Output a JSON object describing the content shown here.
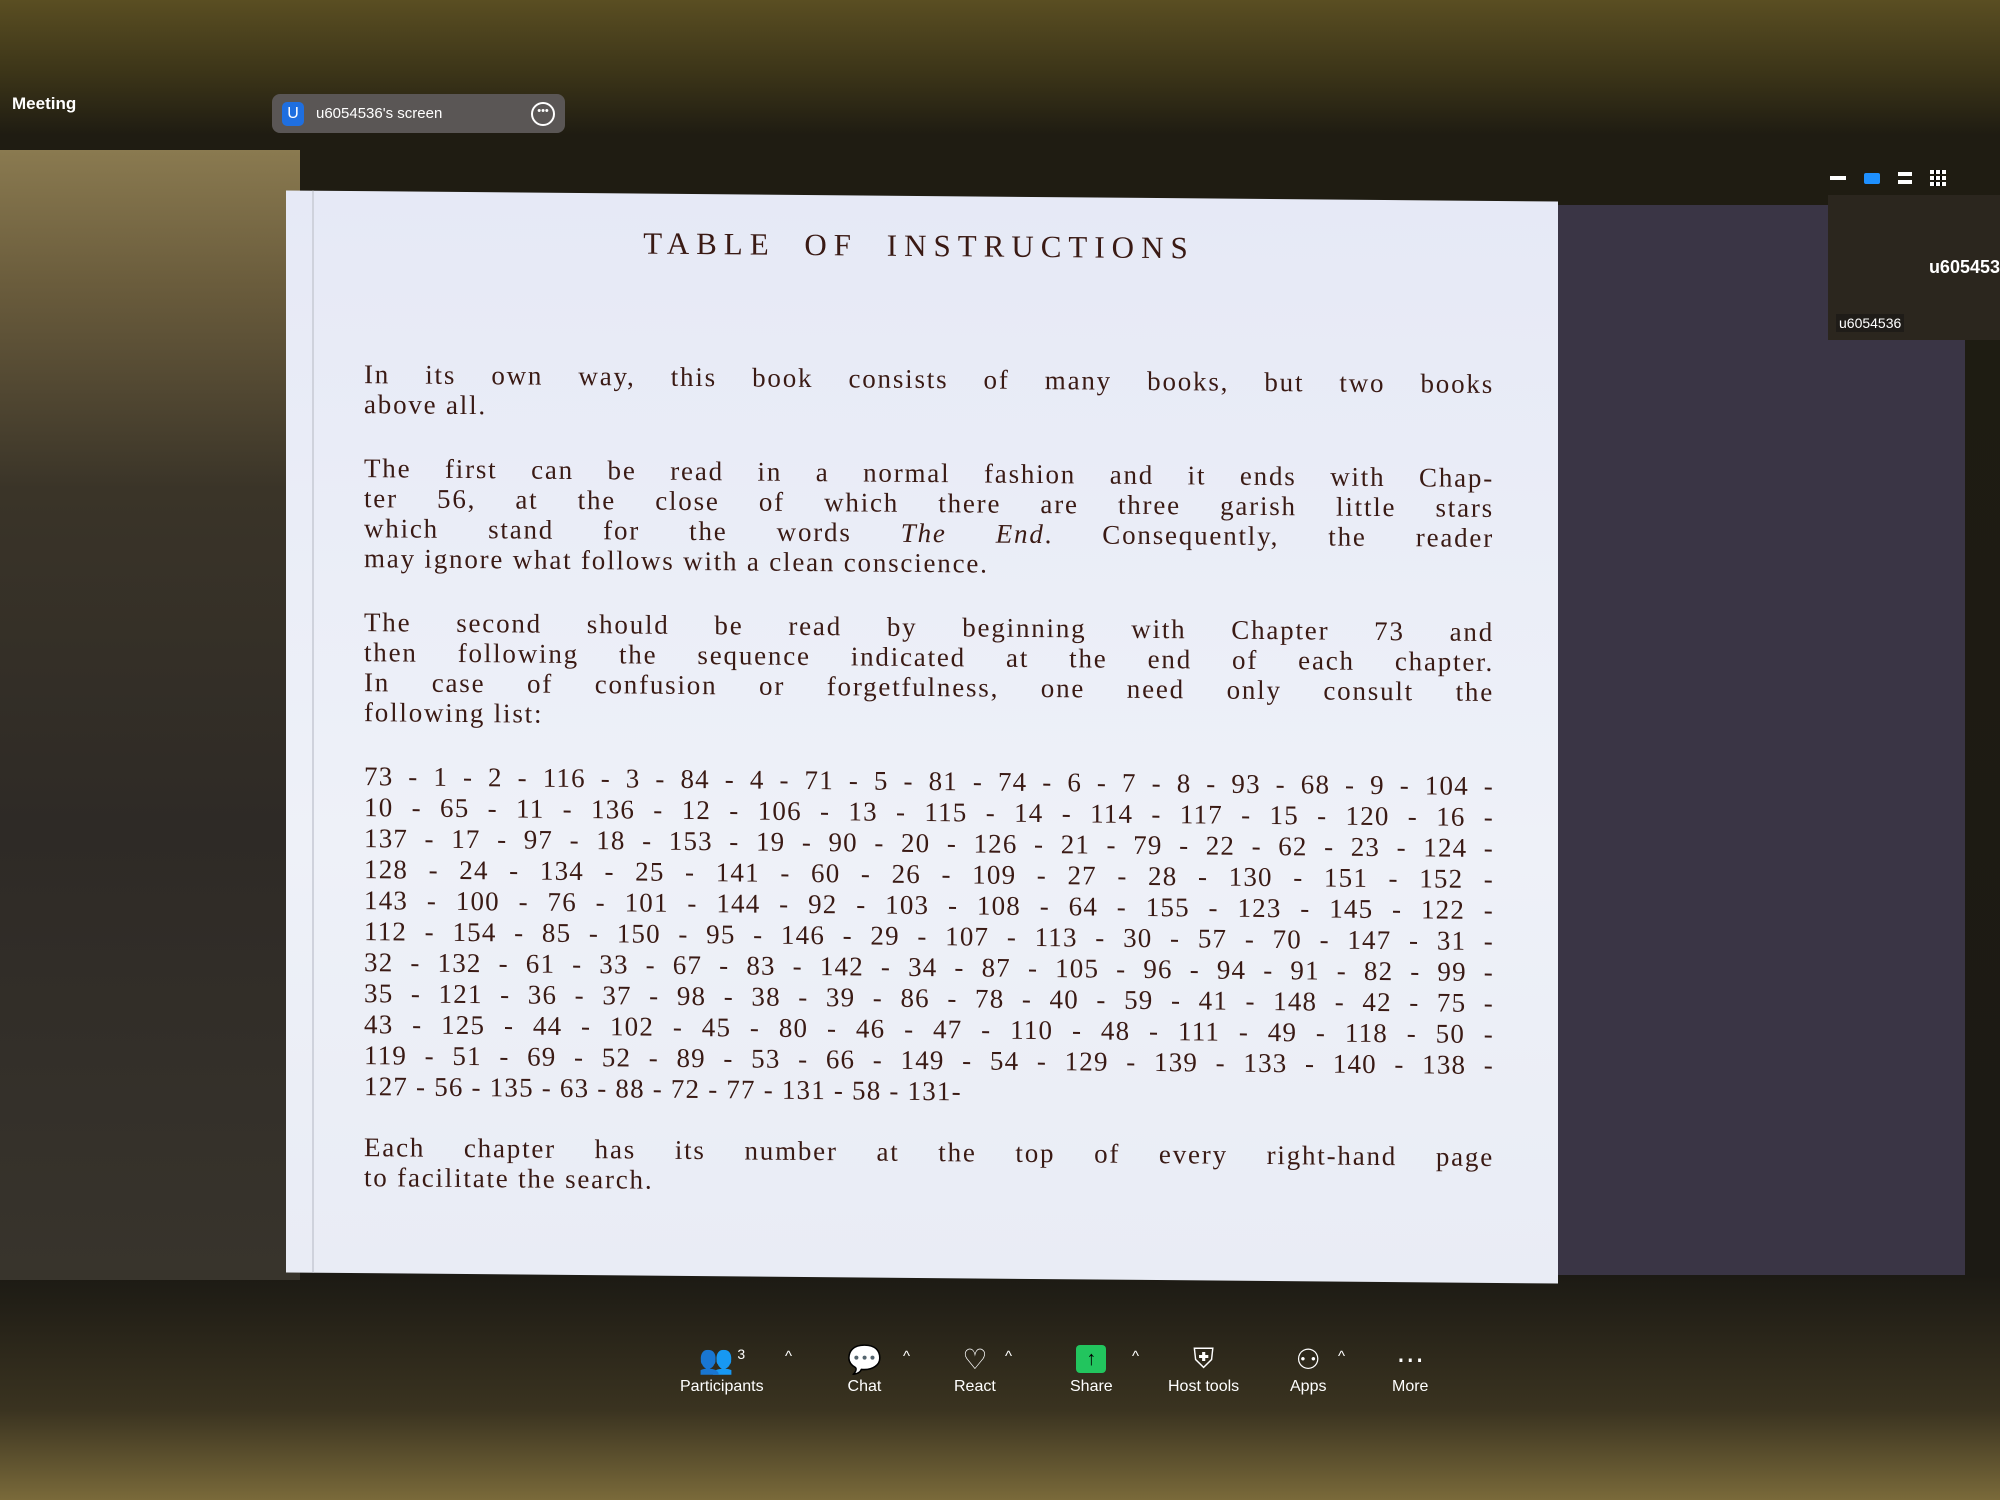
{
  "window": {
    "title": "Meeting"
  },
  "share_pill": {
    "avatar_letter": "U",
    "label": "u6054536's screen"
  },
  "thumbnail": {
    "name_large": "u605453",
    "name_small": "u6054536"
  },
  "slide": {
    "title": "TABLE OF INSTRUCTIONS",
    "para1": [
      "In its own way, this book consists of many books, but two books",
      "above all."
    ],
    "para2": {
      "l1": "The first can be read in a normal fashion and it ends with Chap-",
      "l2": "ter 56, at the close of which there are three garish little stars",
      "l3a": "which stand for the words ",
      "l3b": "The End",
      "l3c": ". Consequently, the reader",
      "l4": "may ignore what follows with a clean conscience."
    },
    "para3": [
      "The second should be read by beginning with Chapter 73 and",
      "then following the sequence indicated at the end of each chapter.",
      "In case of confusion or forgetfulness, one need only consult the",
      "following list:"
    ],
    "sequence": [
      "73 - 1 - 2 - 116 - 3 - 84 - 4 - 71 - 5 - 81 - 74 - 6 - 7 - 8 - 93 - 68 - 9 - 104 -",
      "10 - 65 - 11 - 136 - 12 - 106 - 13 - 115 - 14 - 114 - 117 - 15 - 120 - 16 -",
      "137 - 17 - 97 - 18 - 153 - 19 - 90 - 20 - 126 - 21 - 79 - 22 - 62 - 23 - 124 -",
      "128 - 24 - 134 - 25 - 141 - 60 - 26 - 109 - 27 - 28 - 130 - 151 - 152 -",
      "143 - 100 - 76 - 101 - 144 - 92 - 103 - 108 - 64 - 155 - 123 - 145 - 122 -",
      "112 - 154 - 85 - 150 - 95 - 146 - 29 - 107 - 113 - 30 - 57 - 70 - 147 - 31 -",
      "32 - 132 - 61 - 33 - 67 - 83 - 142 - 34 - 87 - 105 - 96 - 94 - 91 - 82 - 99 -",
      "35 - 121 - 36 - 37 - 98 - 38 - 39 - 86 - 78 - 40 - 59 - 41 - 148 - 42 - 75 -",
      "43 - 125 - 44 - 102 - 45 - 80 - 46 - 47 - 110 - 48 - 111 - 49 - 118 - 50 -",
      "119 - 51 - 69 - 52 - 89 - 53 - 66 - 149 - 54 - 129 - 139 - 133 - 140 - 138 -",
      "127 - 56 - 135 - 63 - 88 - 72 - 77 - 131 - 58 - 131-"
    ],
    "para4": [
      "Each chapter has its number at the top of every right-hand page",
      "to facilitate the search."
    ]
  },
  "toolbar": {
    "participants": {
      "label": "Participants",
      "count": "3",
      "icon": "participants-icon"
    },
    "chat": {
      "label": "Chat",
      "icon": "chat-icon"
    },
    "react": {
      "label": "React",
      "icon": "heart-icon"
    },
    "share": {
      "label": "Share",
      "icon": "share-arrow-icon",
      "color": "#22c55e"
    },
    "host_tools": {
      "label": "Host tools",
      "icon": "shield-icon"
    },
    "apps": {
      "label": "Apps",
      "icon": "apps-icon"
    },
    "more": {
      "label": "More",
      "icon": "more-icon"
    }
  },
  "colors": {
    "accent_blue": "#1f6fe0",
    "slide_text": "#3a1a14"
  }
}
